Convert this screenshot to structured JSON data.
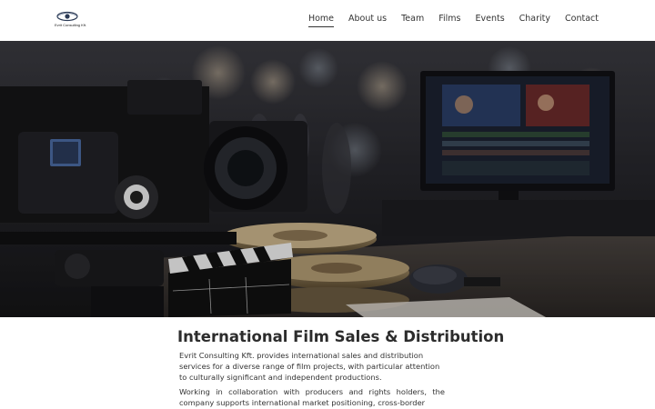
{
  "brand": {
    "logo_text": "Evrit Consulting Kft."
  },
  "nav": {
    "items": [
      {
        "label": "Home",
        "active": true
      },
      {
        "label": "About us",
        "active": false
      },
      {
        "label": "Team",
        "active": false
      },
      {
        "label": "Films",
        "active": false
      },
      {
        "label": "Events",
        "active": false
      },
      {
        "label": "Charity",
        "active": false
      },
      {
        "label": "Contact",
        "active": false
      }
    ]
  },
  "hero": {
    "image_icon": "film-camera-scene-icon"
  },
  "main": {
    "title": "International Film Sales & Distribution",
    "paragraph_1": "Evrit Consulting Kft. provides international sales and distribution services for a diverse range of film projects, with particular attention to culturally significant and independent productions.",
    "paragraph_2": "Working in collaboration with producers and rights holders, the company supports international market positioning, cross-border"
  },
  "colors": {
    "nav_text": "#333333",
    "title": "#2c2c2c",
    "hero_bg": "#1a1a1e"
  }
}
